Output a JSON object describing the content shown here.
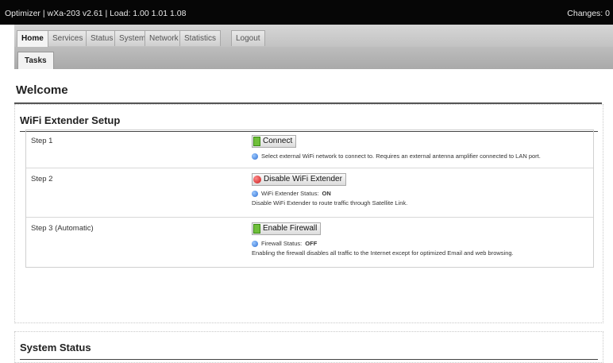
{
  "topbar": {
    "title": "Optimizer | wXa-203 v2.61 | Load: 1.00 1.01 1.08",
    "changes": "Changes: 0"
  },
  "menu": {
    "tabs": [
      "Home",
      "Services",
      "Status",
      "System",
      "Network",
      "Statistics"
    ],
    "logout": "Logout",
    "subtab": "Tasks"
  },
  "page": {
    "welcome": "Welcome",
    "wifi_title": "WiFi Extender Setup",
    "system_status_title": "System Status"
  },
  "steps": [
    {
      "label": "Step 1",
      "button": "Connect",
      "info": "Select external WiFi network to connect to. Requires an external antenna amplifier connected to LAN port."
    },
    {
      "label": "Step 2",
      "button": "Disable WiFi Extender",
      "status_label": "WiFi Extender Status:",
      "status_value": "ON",
      "note": "Disable WiFi Extender to route traffic through Satellite Link."
    },
    {
      "label": "Step 3 (Automatic)",
      "button": "Enable Firewall",
      "status_label": "Firewall Status:",
      "status_value": "OFF",
      "note": "Enabling the firewall disables all traffic to the Internet except for optimized Email and web browsing."
    }
  ],
  "colors": {
    "topbar_bg": "#060606",
    "green_icon": "#6fbf3a",
    "red_icon": "#c81818",
    "info_icon": "#2f6fd2"
  },
  "icons": {
    "connect": "green-square-icon",
    "disable": "red-circle-icon",
    "enable": "green-square-icon",
    "info": "info-icon"
  }
}
